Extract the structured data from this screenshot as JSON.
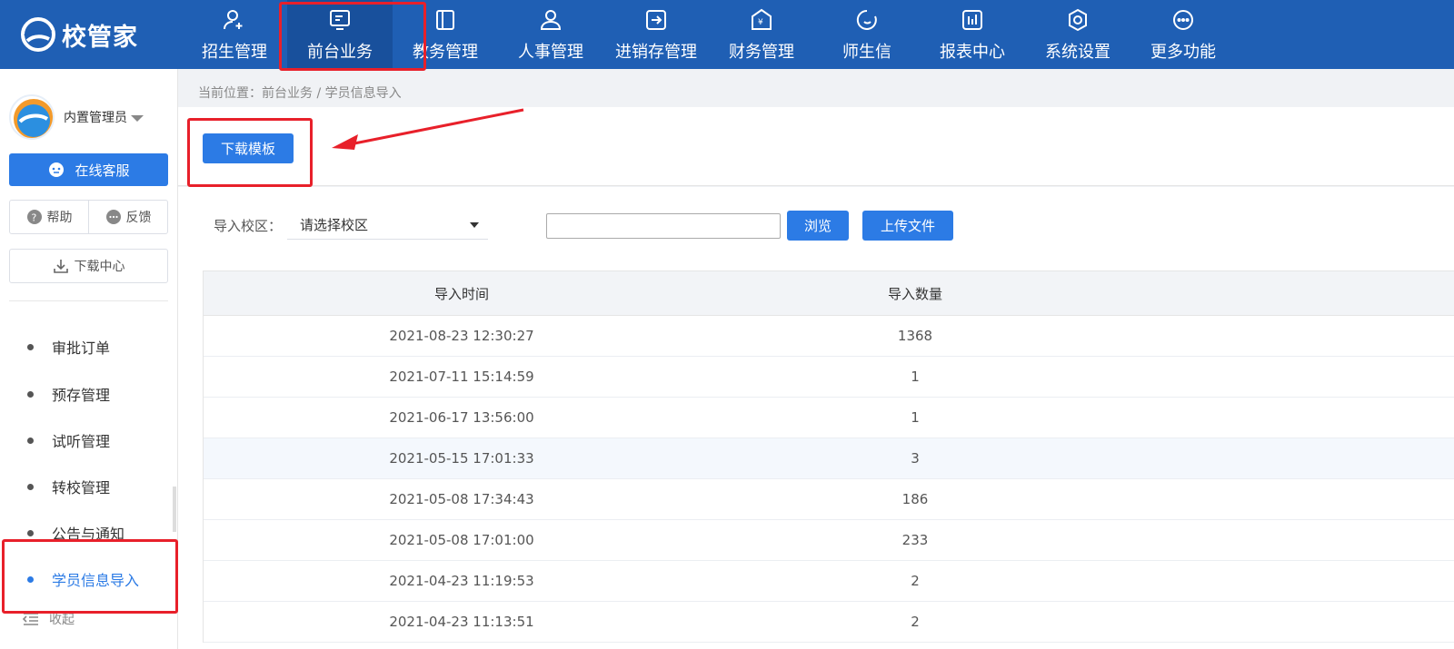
{
  "brand": {
    "name": "校管家"
  },
  "nav": {
    "items": [
      {
        "label": "招生管理",
        "icon": "user-plus-icon"
      },
      {
        "label": "前台业务",
        "icon": "monitor-icon",
        "active": true
      },
      {
        "label": "教务管理",
        "icon": "book-icon"
      },
      {
        "label": "人事管理",
        "icon": "person-icon"
      },
      {
        "label": "进销存管理",
        "icon": "inventory-icon"
      },
      {
        "label": "财务管理",
        "icon": "finance-icon"
      },
      {
        "label": "师生信",
        "icon": "chat-icon"
      },
      {
        "label": "报表中心",
        "icon": "report-icon"
      },
      {
        "label": "系统设置",
        "icon": "settings-icon"
      },
      {
        "label": "更多功能",
        "icon": "more-icon"
      }
    ]
  },
  "sidebar": {
    "user_name": "内置管理员",
    "online_service": "在线客服",
    "help": "帮助",
    "feedback": "反馈",
    "download_center": "下载中心",
    "menu": [
      {
        "label": "审批订单"
      },
      {
        "label": "预存管理"
      },
      {
        "label": "试听管理"
      },
      {
        "label": "转校管理"
      },
      {
        "label": "公告与通知"
      },
      {
        "label": "学员信息导入",
        "active": true
      }
    ],
    "collapse": "收起"
  },
  "breadcrumb": "当前位置：前台业务 / 学员信息导入",
  "toolbar": {
    "download_template": "下载模板",
    "campus_label": "导入校区：",
    "campus_placeholder": "请选择校区",
    "browse": "浏览",
    "upload": "上传文件"
  },
  "table": {
    "headers": [
      "导入时间",
      "导入数量"
    ],
    "rows": [
      [
        "2021-08-23 12:30:27",
        "1368"
      ],
      [
        "2021-07-11 15:14:59",
        "1"
      ],
      [
        "2021-06-17 13:56:00",
        "1"
      ],
      [
        "2021-05-15 17:01:33",
        "3"
      ],
      [
        "2021-05-08 17:34:43",
        "186"
      ],
      [
        "2021-05-08 17:01:00",
        "233"
      ],
      [
        "2021-04-23 11:19:53",
        "2"
      ],
      [
        "2021-04-23 11:13:51",
        "2"
      ]
    ]
  },
  "colors": {
    "nav_bg": "#1f5fb4",
    "primary": "#2c7be5",
    "annotation_red": "#e8202a"
  }
}
